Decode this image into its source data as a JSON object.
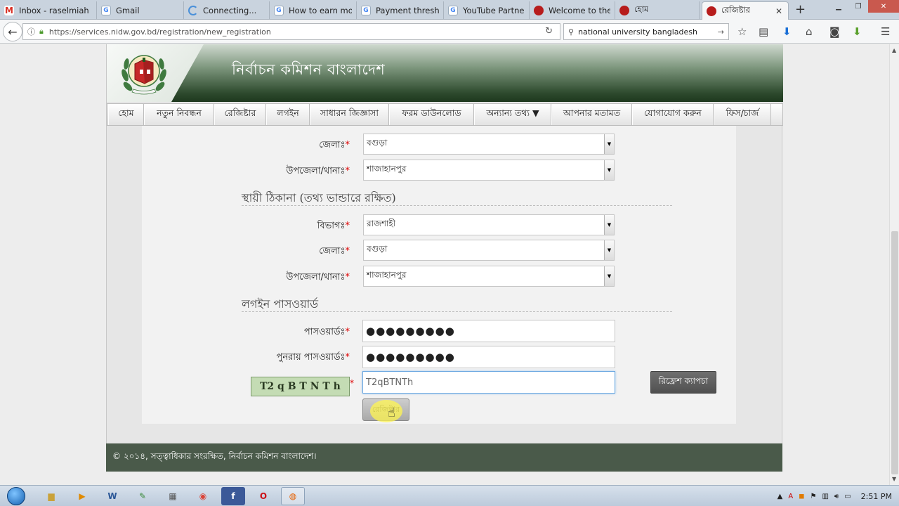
{
  "browser": {
    "tabs": [
      {
        "title": "Inbox - raselmiah",
        "icon": "gmail-icon",
        "icon_color": "#d93025"
      },
      {
        "title": "Gmail",
        "icon": "google-icon",
        "icon_color": "#4285f4"
      },
      {
        "title": "Connecting...",
        "icon": "loading-icon",
        "icon_color": "#4a90d9"
      },
      {
        "title": "How to earn mor",
        "icon": "google-icon",
        "icon_color": "#4285f4"
      },
      {
        "title": "Payment thresho",
        "icon": "google-icon",
        "icon_color": "#4285f4"
      },
      {
        "title": "YouTube Partner",
        "icon": "google-icon",
        "icon_color": "#4285f4"
      },
      {
        "title": "Welcome to the",
        "icon": "nidw-icon",
        "icon_color": "#b71c1c"
      },
      {
        "title": "হোম",
        "icon": "nidw-icon",
        "icon_color": "#b71c1c"
      },
      {
        "title": "রেজিষ্টার",
        "icon": "nidw-icon",
        "icon_color": "#b71c1c",
        "active": true
      }
    ],
    "new_tab_label": "+",
    "url": "https://services.nidw.gov.bd/registration/new_registration",
    "search_text": "national university bangladesh"
  },
  "site": {
    "title": "নির্বাচন কমিশন বাংলাদেশ",
    "menu": [
      "হোম",
      "নতুন নিবন্ধন",
      "রেজিষ্টার",
      "লগইন",
      "সাধারন জিজ্ঞাসা",
      "ফরম ডাউনলোড",
      "অন্যান্য তথ্য ▼",
      "আপনার মতামত",
      "যোগাযোগ করুন",
      "ফিস/চার্জ"
    ]
  },
  "form": {
    "present_address": {
      "district_label": "জেলাঃ",
      "district_value": "বগুড়া",
      "upazila_label": "উপজেলা/থানাঃ",
      "upazila_value": "শাজাহানপুর"
    },
    "permanent_address": {
      "heading": "স্থায়ী ঠিকানা (তথ্য ভান্ডারে রক্ষিত)",
      "division_label": "বিভাগঃ",
      "division_value": "রাজশাহী",
      "district_label": "জেলাঃ",
      "district_value": "বগুড়া",
      "upazila_label": "উপজেলা/থানাঃ",
      "upazila_value": "শাজাহানপুর"
    },
    "login_password": {
      "heading": "লগইন পাসওয়ার্ড",
      "password_label": "পাসওয়ার্ডঃ",
      "password_value": "●●●●●●●●●",
      "confirm_label": "পুনরায় পাসওয়ার্ডঃ",
      "confirm_value": "●●●●●●●●●"
    },
    "required_mark": "*",
    "captcha_image_text": "T2 q B T N T h",
    "captcha_input_value": "T2qBTNTh",
    "refresh_captcha_label": "রিফ্রেশ ক্যাপচা",
    "register_label": "রেজিষ্টার"
  },
  "footer": {
    "text": "© ২০১৪, সত্ত্বাধিকার সংরক্ষিত, নির্বাচন কমিশন বাংলাদেশ।"
  },
  "taskbar": {
    "clock": "2:51 PM",
    "apps": [
      "explorer",
      "media-player",
      "word",
      "notepad",
      "calculator",
      "chrome",
      "facebook",
      "opera",
      "firefox"
    ]
  },
  "colors": {
    "banner_dark": "#1e381e",
    "footer": "#4a5a4a",
    "required": "#dd0000"
  }
}
